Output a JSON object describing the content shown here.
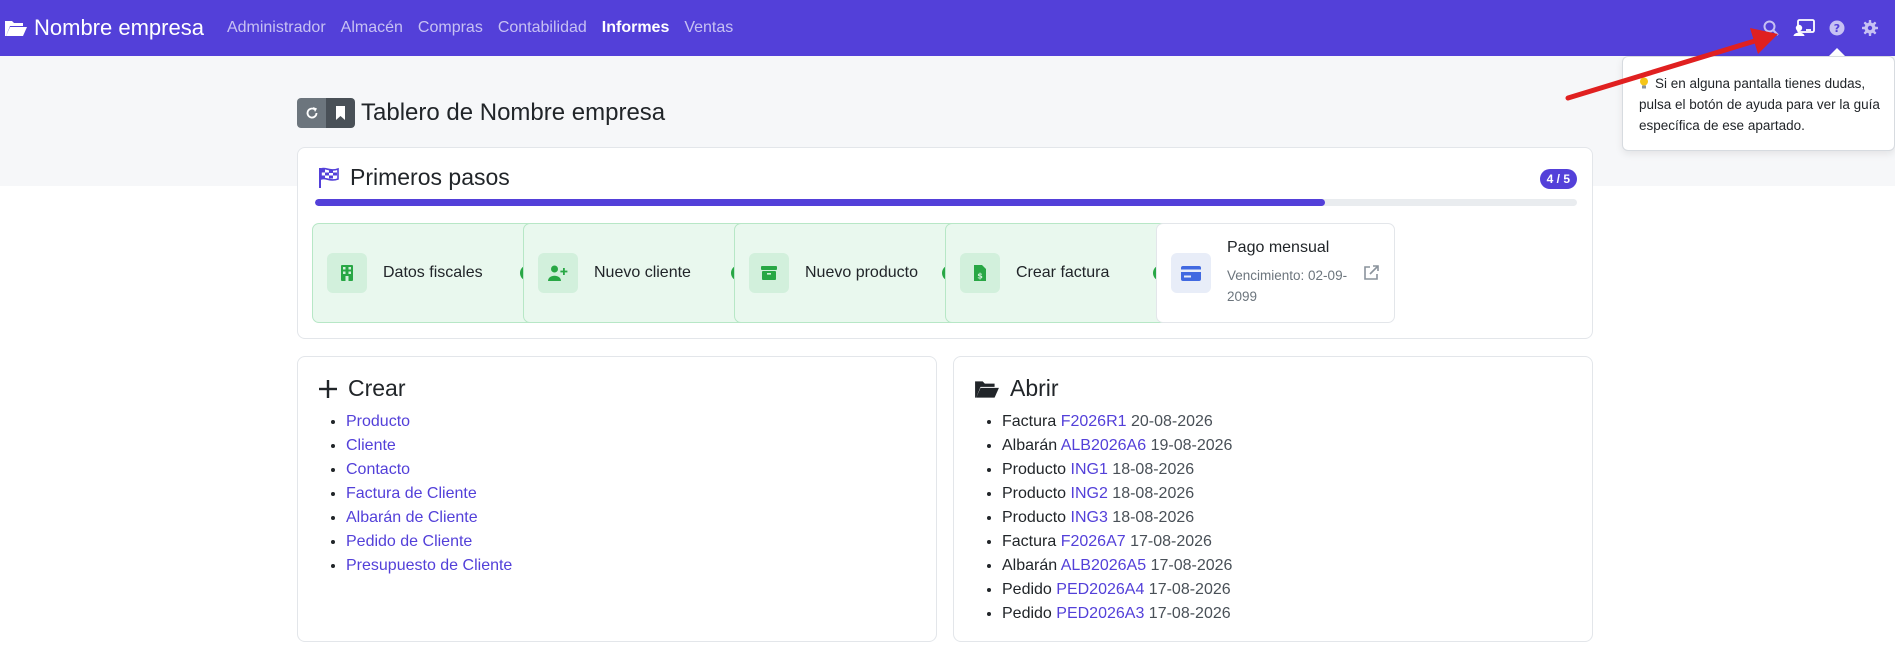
{
  "navbar": {
    "brand": "Nombre empresa",
    "links": [
      "Administrador",
      "Almacén",
      "Compras",
      "Contabilidad",
      "Informes",
      "Ventas"
    ],
    "active_link": "Informes",
    "icons": [
      "search-icon",
      "user-card-icon",
      "help-icon",
      "gear-icon"
    ],
    "color": "#5340d9"
  },
  "page": {
    "title": "Tablero de Nombre empresa"
  },
  "steps": {
    "title": "Primeros pasos",
    "count": "4 / 5",
    "progress_fraction": 0.8,
    "items": [
      {
        "label": "Datos fiscales",
        "icon": "building-icon",
        "done": true
      },
      {
        "label": "Nuevo cliente",
        "icon": "user-plus-icon",
        "done": true
      },
      {
        "label": "Nuevo producto",
        "icon": "box-icon",
        "done": true
      },
      {
        "label": "Crear factura",
        "icon": "invoice-icon",
        "done": true
      }
    ],
    "pending": {
      "title": "Pago mensual",
      "subtitle": "Vencimiento: 02-09-2099",
      "icon": "credit-card-icon"
    }
  },
  "crear": {
    "title": "Crear",
    "items": [
      "Producto",
      "Cliente",
      "Contacto",
      "Factura de Cliente",
      "Albarán de Cliente",
      "Pedido de Cliente",
      "Presupuesto de Cliente"
    ]
  },
  "abrir": {
    "title": "Abrir",
    "items": [
      {
        "type": "Factura",
        "code": "F2026R1",
        "date": "20-08-2026"
      },
      {
        "type": "Albarán",
        "code": "ALB2026A6",
        "date": "19-08-2026"
      },
      {
        "type": "Producto",
        "code": "ING1",
        "date": "18-08-2026"
      },
      {
        "type": "Producto",
        "code": "ING2",
        "date": "18-08-2026"
      },
      {
        "type": "Producto",
        "code": "ING3",
        "date": "18-08-2026"
      },
      {
        "type": "Factura",
        "code": "F2026A7",
        "date": "17-08-2026"
      },
      {
        "type": "Albarán",
        "code": "ALB2026A5",
        "date": "17-08-2026"
      },
      {
        "type": "Pedido",
        "code": "PED2026A4",
        "date": "17-08-2026"
      },
      {
        "type": "Pedido",
        "code": "PED2026A3",
        "date": "17-08-2026"
      }
    ]
  },
  "tooltip": {
    "text": "Si en alguna pantalla tienes dudas, pulsa el botón de ayuda para ver la guía específica de ese apartado."
  }
}
